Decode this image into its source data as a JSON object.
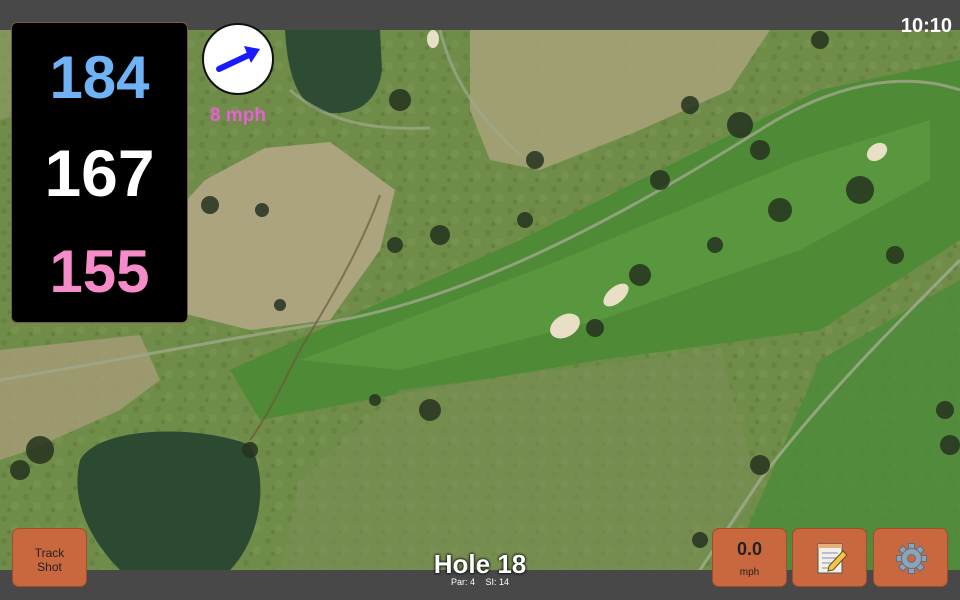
{
  "status_bar": {
    "clock": "10:10"
  },
  "distances": {
    "back": "184",
    "middle": "167",
    "front": "155"
  },
  "wind": {
    "speed_label": "8 mph",
    "direction_icon": "arrow-right-up-icon"
  },
  "buttons": {
    "track_shot_line1": "Track",
    "track_shot_line2": "Shot",
    "speed_value": "0.0",
    "speed_unit": "mph",
    "notes_icon": "notepad-icon",
    "settings_icon": "gear-icon"
  },
  "hole": {
    "title": "Hole 18",
    "par": "Par: 4",
    "si": "SI: 14"
  },
  "colors": {
    "back_distance": "#6fb2f5",
    "middle_distance": "#ffffff",
    "front_distance": "#f58cc9",
    "button": "#c9683e",
    "wind_text": "#e85fd6"
  }
}
